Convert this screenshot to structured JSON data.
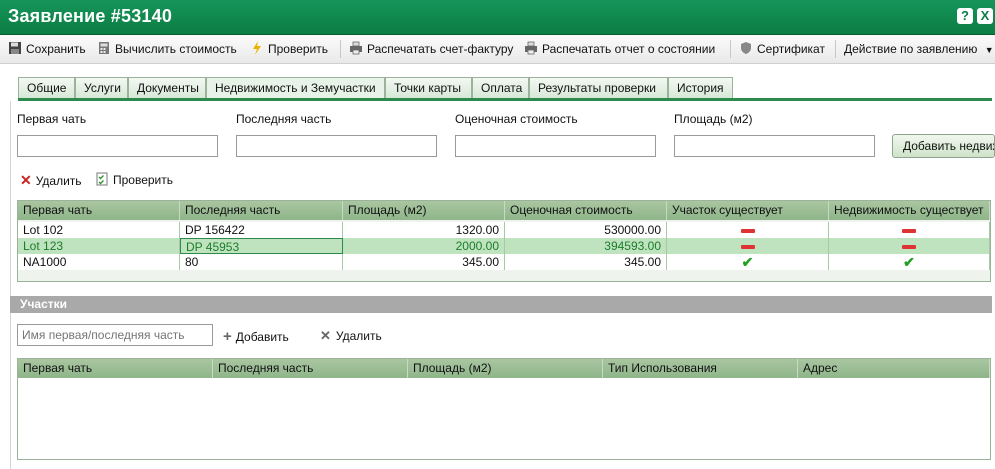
{
  "window": {
    "title": "Заявление #53140",
    "help_symbol": "?",
    "close_symbol": "X"
  },
  "toolbar": {
    "save": "Сохранить",
    "calc_cost": "Вычислить стоимость",
    "check": "Проверить",
    "print_invoice": "Распечатать счет-фактуру",
    "print_status": "Распечатать отчет о состоянии",
    "certificate": "Сертификат",
    "actions": "Действие по заявлению"
  },
  "tabs": [
    {
      "label": "Общие",
      "active": false
    },
    {
      "label": "Услуги",
      "active": false
    },
    {
      "label": "Документы",
      "active": false
    },
    {
      "label": "Недвижимость и Земучастки",
      "active": true
    },
    {
      "label": "Точки карты",
      "active": false
    },
    {
      "label": "Оплата",
      "active": false
    },
    {
      "label": "Результаты проверки",
      "active": false
    },
    {
      "label": "История",
      "active": false
    }
  ],
  "form": {
    "first_part_label": "Первая чать",
    "last_part_label": "Последняя часть",
    "estimated_value_label": "Оценочная стоимость",
    "area_label": "Площадь (м2)",
    "first_part_value": "",
    "last_part_value": "",
    "estimated_value_value": "",
    "area_value": "",
    "add_button": "Добавить недвижимость"
  },
  "property_actions": {
    "delete": "Удалить",
    "check": "Проверить"
  },
  "property_table": {
    "columns": [
      "Первая чать",
      "Последняя часть",
      "Площадь (м2)",
      "Оценочная стоимость",
      "Участок существует",
      "Недвижимость существует"
    ],
    "rows": [
      {
        "first": "Lot 102",
        "last": "DP 156422",
        "area": "1320.00",
        "value": "530000.00",
        "parcel_exists": "no",
        "property_exists": "no",
        "selected": false
      },
      {
        "first": "Lot 123",
        "last": "DP 45953",
        "area": "2000.00",
        "value": "394593.00",
        "parcel_exists": "no",
        "property_exists": "no",
        "selected": true
      },
      {
        "first": "NA1000",
        "last": "80",
        "area": "345.00",
        "value": "345.00",
        "parcel_exists": "yes",
        "property_exists": "yes",
        "selected": false
      }
    ]
  },
  "parcels": {
    "section_title": "Участки",
    "search_placeholder": "Имя первая/последняя часть",
    "add": "Добавить",
    "delete": "Удалить",
    "columns": [
      "Первая чать",
      "Последняя часть",
      "Площадь (м2)",
      "Тип Использования",
      "Адрес"
    ],
    "rows": []
  },
  "colors": {
    "header_green": "#0b7d44",
    "selected_row_text": "#1a7d2a",
    "minus_red": "#d33333",
    "check_green": "#22a022"
  }
}
